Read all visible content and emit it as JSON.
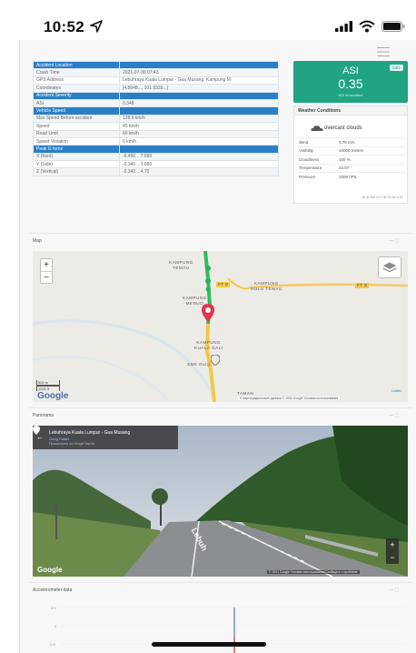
{
  "status_bar": {
    "time": "10:52"
  },
  "accident_table": {
    "rows": [
      {
        "type": "head",
        "label": "Accident Location",
        "value": ""
      },
      {
        "type": "odd",
        "label": "Crash Time",
        "value": "2021-07-30 07:43"
      },
      {
        "type": "even",
        "label": "GPS Address",
        "value": "Lebuhraya Kuala Lumpur - Gua Musang, Kampung M"
      },
      {
        "type": "odd",
        "label": "Coordinates",
        "value": "[4.8648..., 101.9339...]"
      },
      {
        "type": "head",
        "label": "Accident Severity",
        "value": ""
      },
      {
        "type": "odd",
        "label": "ASI",
        "value": "0.348"
      },
      {
        "type": "head",
        "label": "Vehicle Speed",
        "value": ""
      },
      {
        "type": "odd",
        "label": "Max Speed Before accident",
        "value": "128.9 km/h"
      },
      {
        "type": "even",
        "label": "Speed",
        "value": "45 km/h"
      },
      {
        "type": "odd",
        "label": "Road Limit",
        "value": "60 km/h"
      },
      {
        "type": "even",
        "label": "Speed Violation",
        "value": "0 km/h"
      },
      {
        "type": "head",
        "label": "Peak G force",
        "value": ""
      },
      {
        "type": "odd",
        "label": "X (front)",
        "value": "-0.490 .. 7.690"
      },
      {
        "type": "even",
        "label": "Y (Side)",
        "value": "-0.340 .. 3.890"
      },
      {
        "type": "odd",
        "label": "Z (Vertical)",
        "value": "-0.340 .. 4.70"
      }
    ]
  },
  "asi_card": {
    "title": "ASI",
    "value": "0.35",
    "subtitle": "ASI of accident",
    "badge": "Safe",
    "color": "#21a484"
  },
  "weather": {
    "header": "Weather Conditions",
    "condition": "overcast clouds",
    "rows": [
      {
        "label": "Wind",
        "value": "0.78 m/s"
      },
      {
        "label": "Visibility",
        "value": "10000 meters"
      },
      {
        "label": "Cloudiness",
        "value": "100 %"
      },
      {
        "label": "Temperature",
        "value": "23.87 °"
      },
      {
        "label": "Pressure",
        "value": "1009 hPa"
      }
    ],
    "footer": "as at 2021-07-30 22:43 UTC"
  },
  "sections": {
    "map": "Map",
    "panorama": "Panorama",
    "accel": "Accelerometer data",
    "controls": "— ⬚"
  },
  "map": {
    "zoom_in": "+",
    "zoom_out": "−",
    "labels": {
      "kampung_temau": "KAMPUNG\nTEMAU",
      "hulu_temau": "KAMPUNG\nHULU TEMAU",
      "menuo": "KAMPUNG\nMENUO",
      "kuala_gali": "KAMPUNG\nKUALA GALI",
      "sk_durg": "SMK Durg",
      "taman": "TAMAN",
      "route_a": "FT 8",
      "route_b": "FT 8"
    },
    "scale_m": "500 m",
    "scale_ft": "1000 ft",
    "google": "Google",
    "attribution": "© Картографические данные © 2021 Google   Условия использования",
    "leaflet": "Leaflet"
  },
  "panorama": {
    "back": "←",
    "title": "Lebuhraya Kuala Lumpur - Gua Musang",
    "subtitle": "Gong Patani",
    "link": "Просмотреть на Google Картах",
    "google": "Google",
    "attribution": "© 2021 Google   Условия использования   Сообщить о проблеме",
    "zoom_in": "+",
    "zoom_out": "−",
    "road_text": "Lebuh"
  },
  "accel": {
    "y_ticks": [
      "0.5",
      "0",
      "-0.5"
    ]
  }
}
